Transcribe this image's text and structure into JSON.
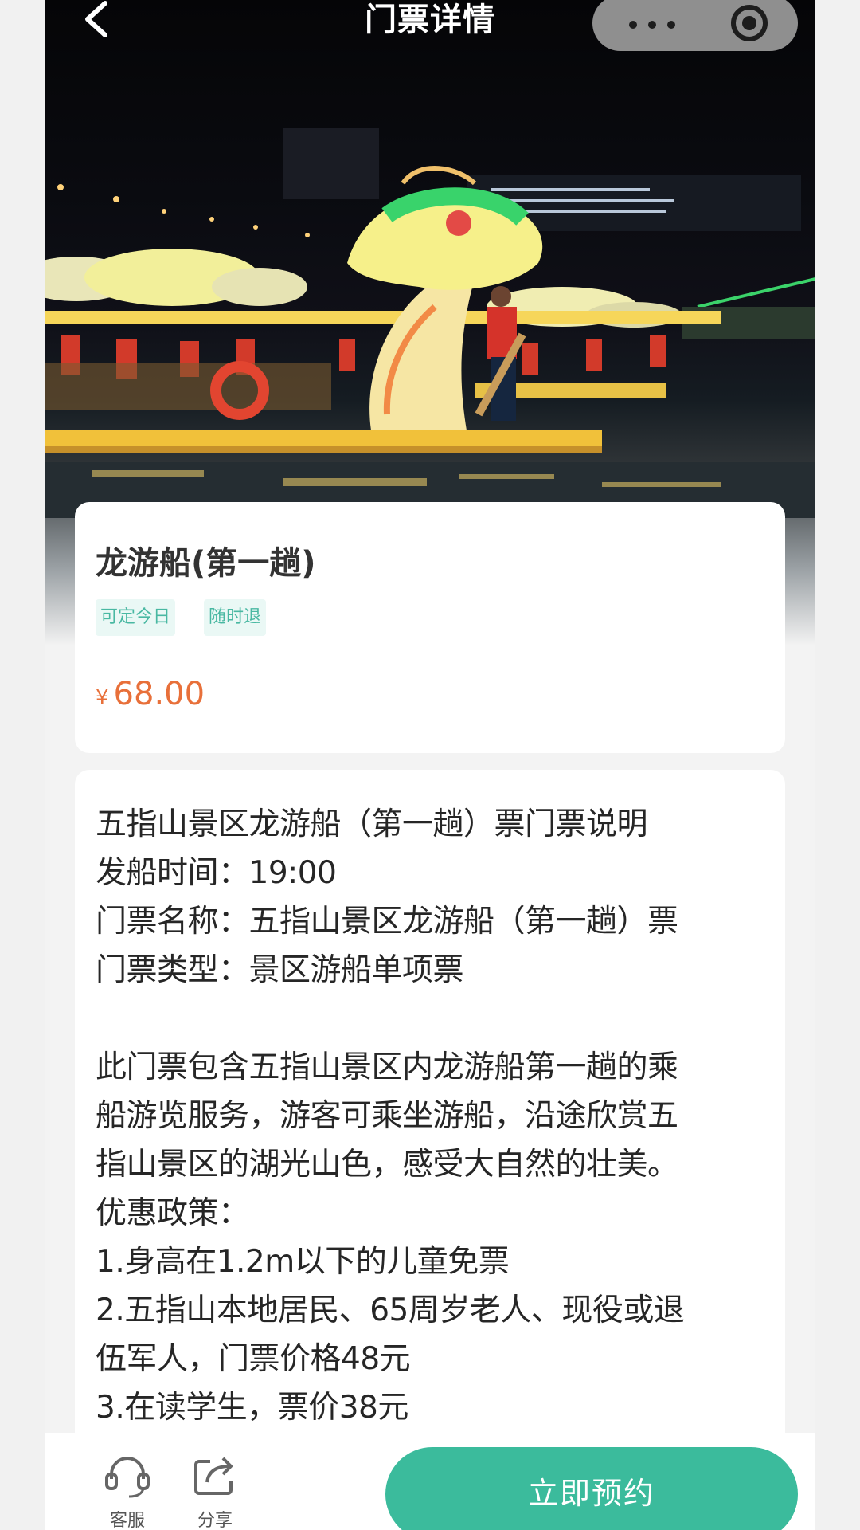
{
  "nav": {
    "title": "门票详情",
    "back_icon": "chevron-left-icon",
    "more_icon": "more-dots-icon",
    "close_icon": "miniprogram-close-icon"
  },
  "ticket": {
    "title": "龙游船(第一趟)",
    "tags": [
      "可定今日",
      "随时退"
    ],
    "currency": "¥",
    "price": "68.00"
  },
  "description": {
    "lines": [
      "五指山景区龙游船（第一趟）票门票说明",
      "发船时间：19:00",
      "门票名称：五指山景区龙游船（第一趟）票",
      "门票类型：景区游船单项票",
      "",
      "此门票包含五指山景区内龙游船第一趟的乘",
      "船游览服务，游客可乘坐游船，沿途欣赏五",
      "指山景区的湖光山色，感受大自然的壮美。",
      "优惠政策：",
      "1.身高在1.2m以下的儿童免票",
      "2.五指山本地居民、65周岁老人、现役或退",
      "伍军人，门票价格48元",
      "3.在读学生，票价38元"
    ]
  },
  "bottom_bar": {
    "service_label": "客服",
    "share_label": "分享",
    "book_label": "立即预约"
  },
  "colors": {
    "accent": "#3bbb9c",
    "price": "#e8703a",
    "tag_text": "#49b8a2",
    "tag_bg": "#eaf8f5"
  }
}
